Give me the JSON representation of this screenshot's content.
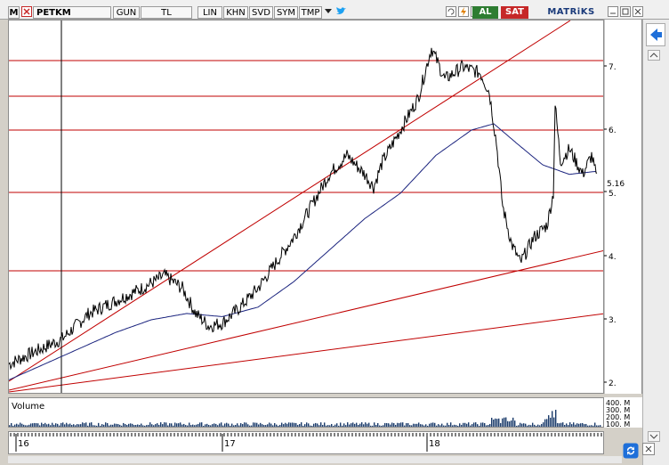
{
  "toolbar": {
    "menu_letter": "M",
    "symbol": "PETKM",
    "buttons": [
      "GUN",
      "TL",
      "LIN",
      "KHN",
      "SVD",
      "SYM",
      "TMP"
    ],
    "brand": "MATRiKS",
    "buy_label": "AL",
    "sell_label": "SAT"
  },
  "price_axis": {
    "ticks": [
      "7.",
      "6.",
      "5.",
      "4.",
      "3.",
      "2."
    ],
    "last_price": "5.16"
  },
  "volume": {
    "title": "Volume",
    "ticks": [
      "400. M",
      "300. M",
      "200. M",
      "100. M"
    ]
  },
  "time_axis": {
    "labels": [
      "16",
      "17",
      "18"
    ]
  },
  "colors": {
    "price": "#000000",
    "moving_average": "#1a237e",
    "lines": "#c00000",
    "volume": "#1a3a6a",
    "buy": "#2e7d32",
    "sell": "#c62828"
  },
  "icons": {
    "close": "close-icon",
    "bolt": "bolt-icon",
    "refresh": "refresh-icon",
    "twitter": "bird-icon",
    "back": "arrow-left-icon",
    "sync": "sync-icon"
  }
}
